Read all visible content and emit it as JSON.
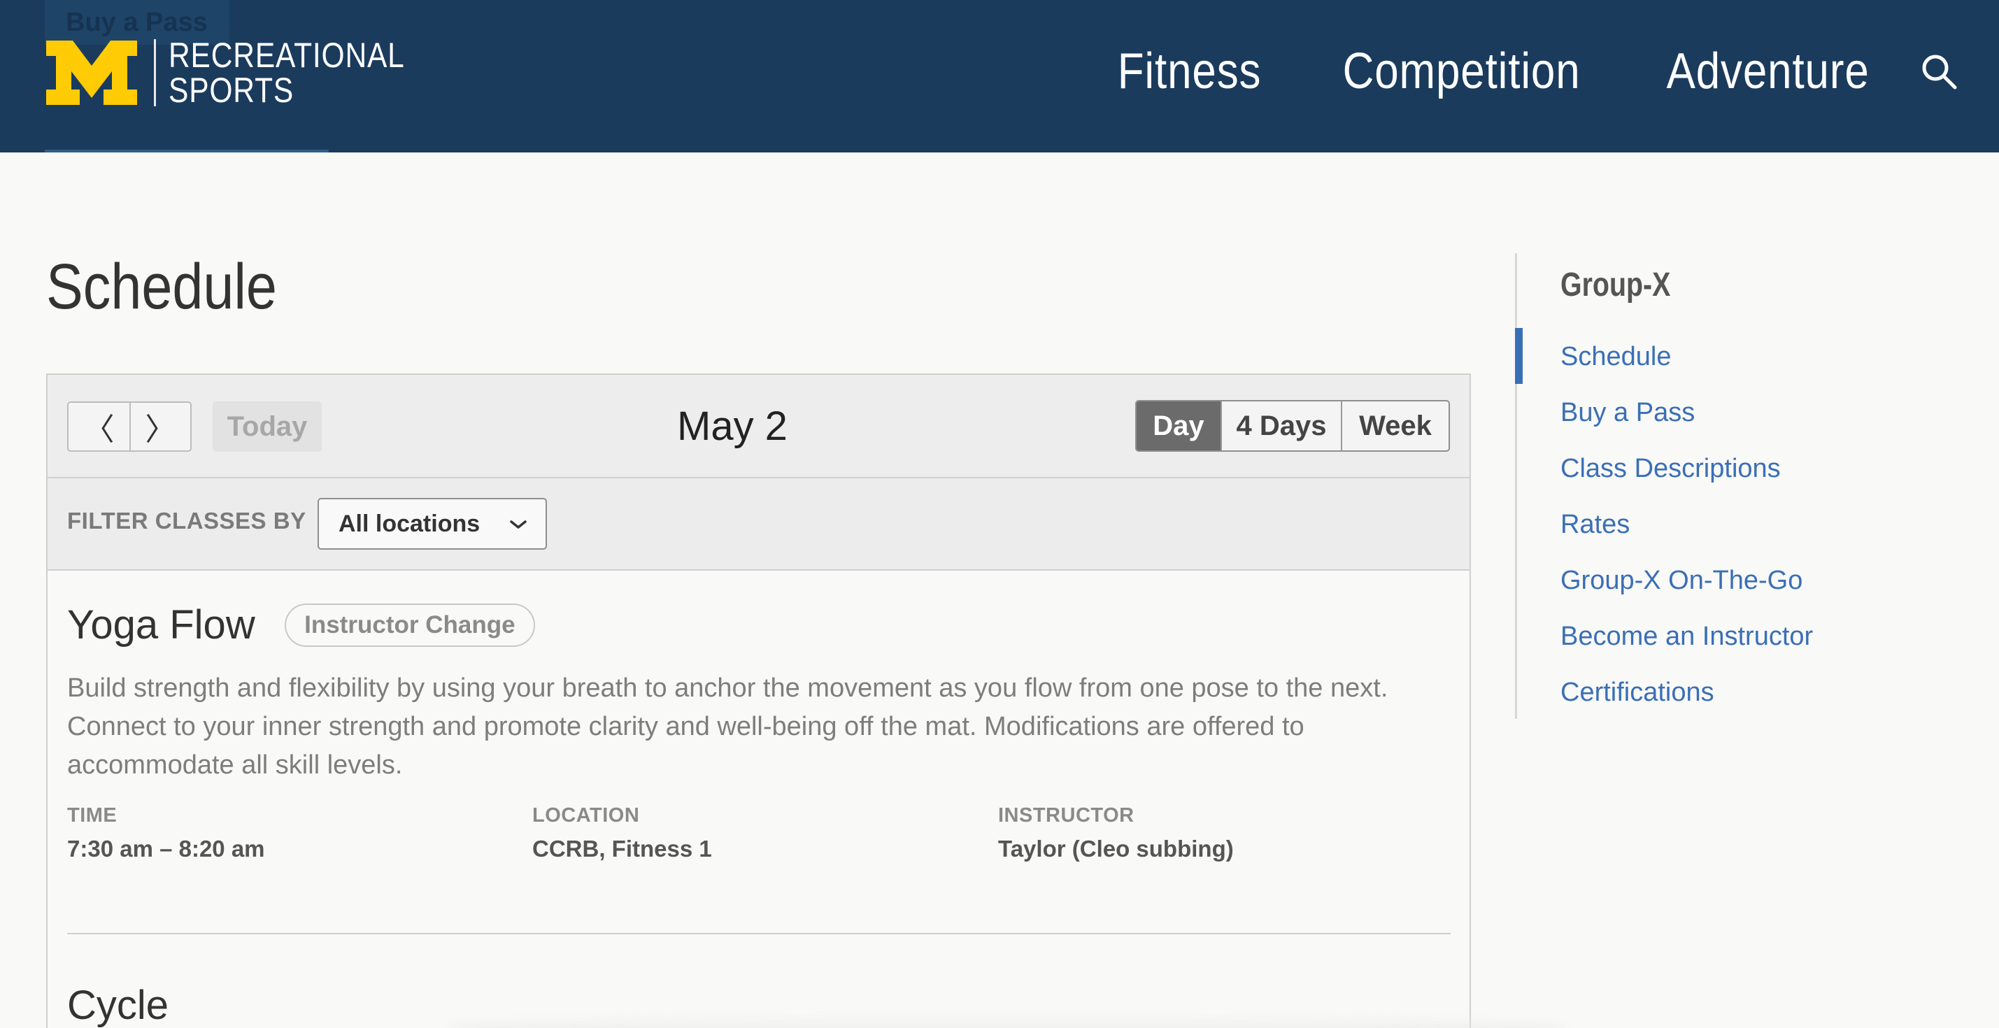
{
  "header": {
    "skip_link": "Buy a Pass",
    "logo_line1": "RECREATIONAL",
    "logo_line2": "SPORTS",
    "nav": [
      "Fitness",
      "Competition",
      "Adventure"
    ],
    "brand_color": "#1b3b5d",
    "logo_color": "#ffcb05"
  },
  "page": {
    "title": "Schedule"
  },
  "schedule": {
    "prev_label": "〈",
    "next_label": "〉",
    "today_label": "Today",
    "date": "May 2",
    "views": [
      "Day",
      "4 Days",
      "Week"
    ],
    "active_view": "Day",
    "filter_label": "FILTER CLASSES BY",
    "filter_value": "All locations",
    "classes": [
      {
        "title": "Yoga Flow",
        "badge": "Instructor Change",
        "description": "Build strength and flexibility by using your breath to anchor the movement as you flow from one pose to the next. Connect to your inner strength and promote clarity and well-being off the mat. Modifications are offered to accommodate all skill levels.",
        "time_label": "TIME",
        "time": "7:30 am – 8:20 am",
        "location_label": "LOCATION",
        "location": "CCRB, Fitness 1",
        "instructor_label": "INSTRUCTOR",
        "instructor": "Taylor (Cleo subbing)"
      },
      {
        "title": "Cycle"
      }
    ]
  },
  "sidebar": {
    "heading": "Group-X",
    "items": [
      {
        "label": "Schedule"
      },
      {
        "label": "Buy a Pass"
      },
      {
        "label": "Class Descriptions"
      },
      {
        "label": "Rates"
      },
      {
        "label": "Group-X On-The-Go"
      },
      {
        "label": "Become an Instructor"
      },
      {
        "label": "Certifications"
      }
    ],
    "link_color": "#3a6fb6"
  }
}
